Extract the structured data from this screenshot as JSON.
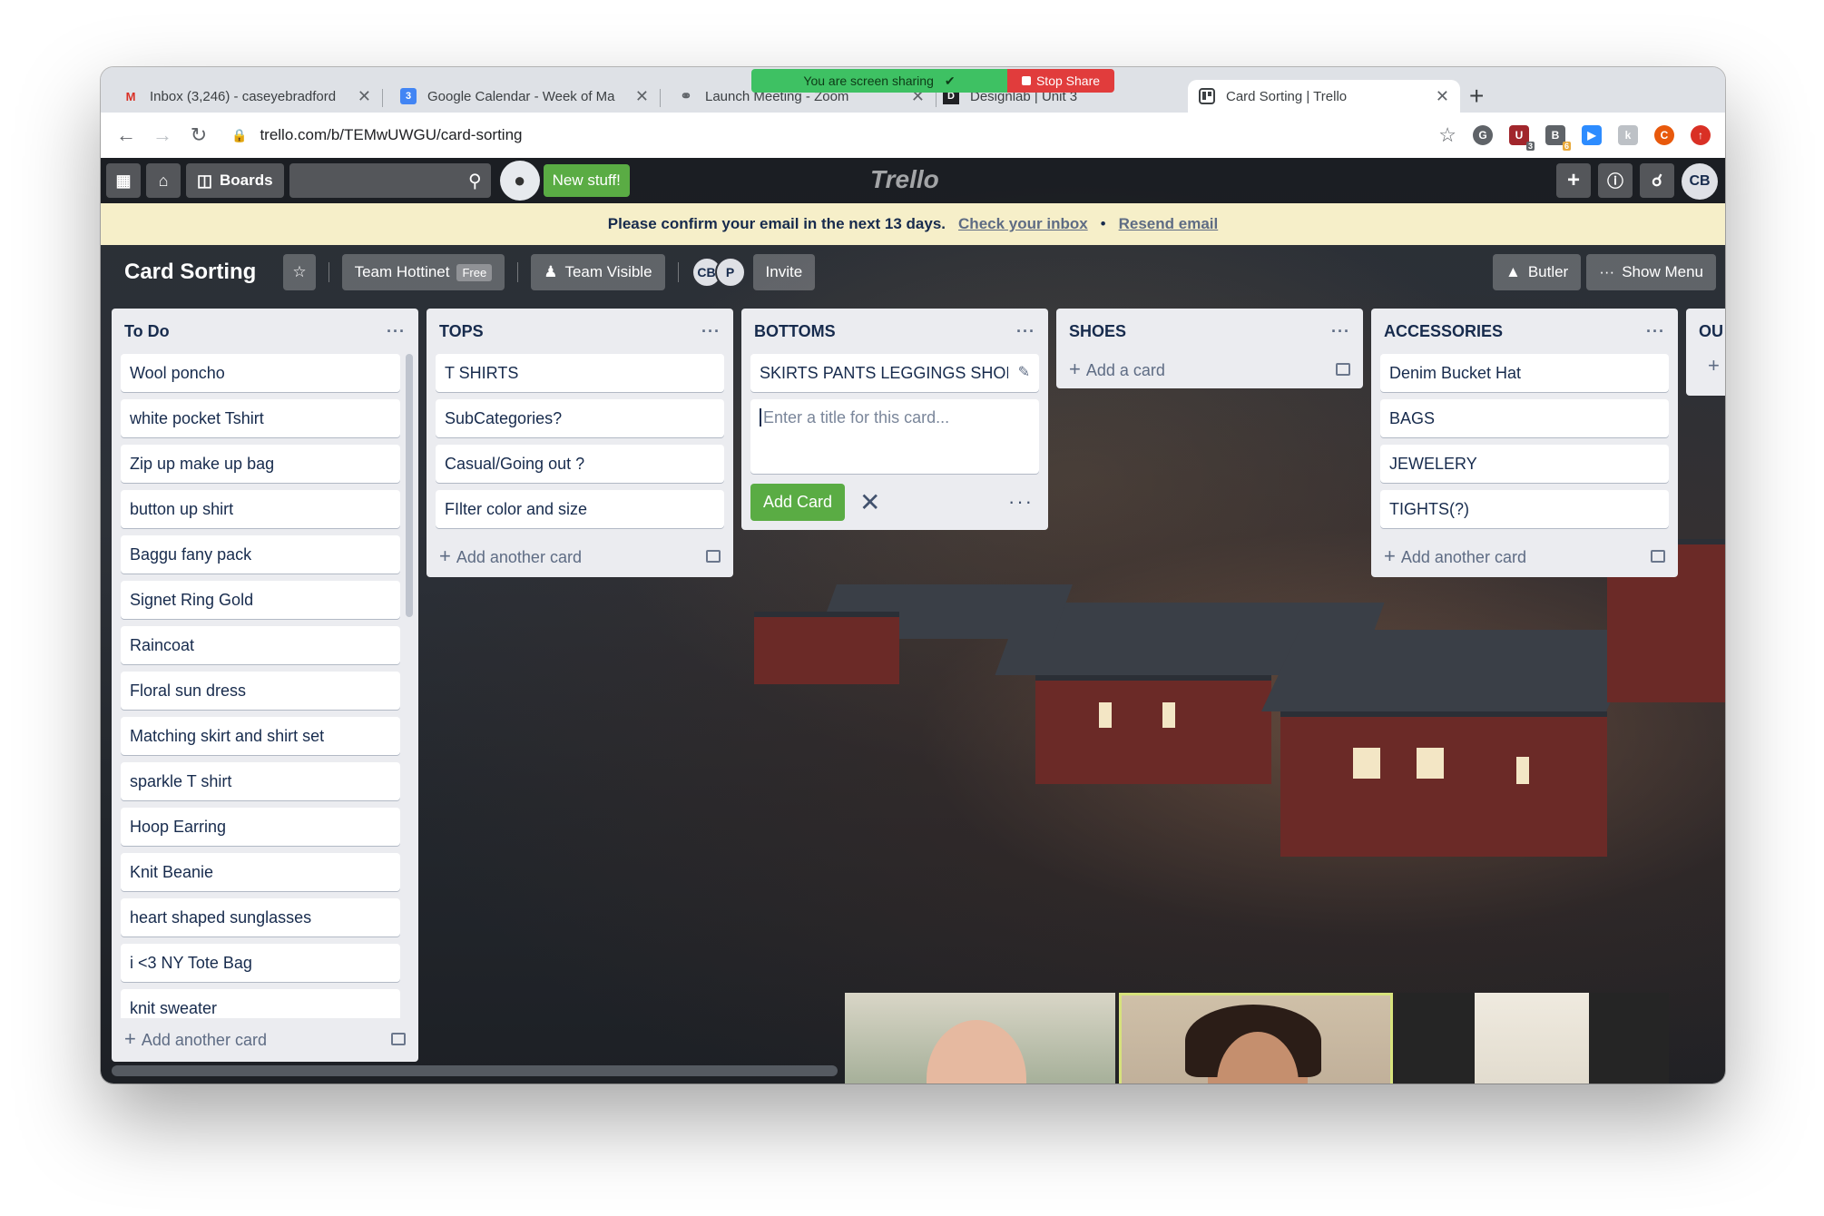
{
  "browser": {
    "tabs": [
      {
        "title": "Inbox (3,246) - caseyebradford",
        "icon": "gmail-icon"
      },
      {
        "title": "Google Calendar - Week of Ma",
        "icon": "calendar-icon"
      },
      {
        "title": "Launch Meeting - Zoom",
        "icon": "globe-icon"
      },
      {
        "title": "Designlab | Unit 3",
        "icon": "designlab-icon"
      },
      {
        "title": "Card Sorting | Trello",
        "icon": "trello-icon"
      }
    ],
    "url": "trello.com/b/TEMwUWGU/card-sorting",
    "screen_share": {
      "status": "You are screen sharing",
      "stop_label": "Stop Share"
    },
    "extensions": [
      "extension-1",
      "extension-2",
      "extension-3",
      "extension-4",
      "extension-5",
      "profile-c",
      "extension-7"
    ],
    "extension_badges": {
      "shield": "3",
      "bird": "6"
    },
    "profile_initial": "C"
  },
  "trello": {
    "header": {
      "boards_label": "Boards",
      "new_stuff_label": "New stuff!",
      "logo": "Trello",
      "user_initials": "CB"
    },
    "banner": {
      "message": "Please confirm your email in the next 13 days.",
      "check_inbox": "Check your inbox",
      "separator": "•",
      "resend": "Resend email"
    },
    "board": {
      "title": "Card Sorting",
      "team": "Team Hottinet",
      "plan_badge": "Free",
      "visibility": "Team Visible",
      "members": [
        "CB",
        "P"
      ],
      "invite_label": "Invite",
      "butler_label": "Butler",
      "show_menu_label": "Show Menu"
    },
    "lists": [
      {
        "title": "To Do",
        "cards": [
          "Wool poncho",
          "white pocket Tshirt",
          "Zip up make up bag",
          "button up shirt",
          "Baggu fany pack",
          "Signet Ring Gold",
          "Raincoat",
          "Floral sun dress",
          "Matching skirt and shirt set",
          "sparkle T shirt",
          "Hoop Earring",
          "Knit Beanie",
          "heart shaped sunglasses",
          "i <3 NY Tote Bag",
          "knit sweater"
        ],
        "add_label": "Add another card"
      },
      {
        "title": "TOPS",
        "cards": [
          "T SHIRTS",
          "SubCategories?",
          "Casual/Going out ?",
          "FIlter color and size"
        ],
        "add_label": "Add another card"
      },
      {
        "title": "BOTTOMS",
        "cards": [
          "SKIRTS PANTS LEGGINGS SHORTS"
        ],
        "composer_placeholder": "Enter a title for this card...",
        "add_card_button": "Add Card"
      },
      {
        "title": "SHOES",
        "cards": [],
        "add_label": "Add a card"
      },
      {
        "title": "ACCESSORIES",
        "cards": [
          "Denim Bucket Hat",
          "BAGS",
          "JEWELERY",
          "TIGHTS(?)"
        ],
        "add_label": "Add another card"
      },
      {
        "title": "OU",
        "cards": []
      }
    ]
  },
  "colors": {
    "trello_green": "#5aac44",
    "banner_bg": "#f6efc9",
    "list_bg": "#ebecf0",
    "share_green": "#3ec163",
    "share_red": "#e13c3c"
  }
}
